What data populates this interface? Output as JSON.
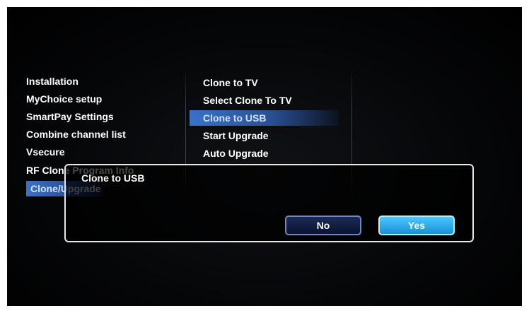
{
  "left_menu": {
    "items": [
      {
        "label": "Installation"
      },
      {
        "label": "MyChoice setup"
      },
      {
        "label": "SmartPay Settings"
      },
      {
        "label": "Combine channel list"
      },
      {
        "label": "Vsecure"
      },
      {
        "label": "RF Clone Program Info"
      },
      {
        "label": "Clone/Upgrade",
        "selected": true
      }
    ]
  },
  "submenu": {
    "items": [
      {
        "label": "Clone to TV"
      },
      {
        "label": "Select Clone To TV"
      },
      {
        "label": "Clone to USB",
        "selected": true
      },
      {
        "label": "Start Upgrade"
      },
      {
        "label": "Auto Upgrade"
      }
    ]
  },
  "dialog": {
    "title": "Clone to USB",
    "no_label": "No",
    "yes_label": "Yes"
  },
  "color_keys": {
    "colors": [
      "#e0354a",
      "#3fd04a",
      "#f1e64a",
      "#3aa8f0"
    ]
  }
}
